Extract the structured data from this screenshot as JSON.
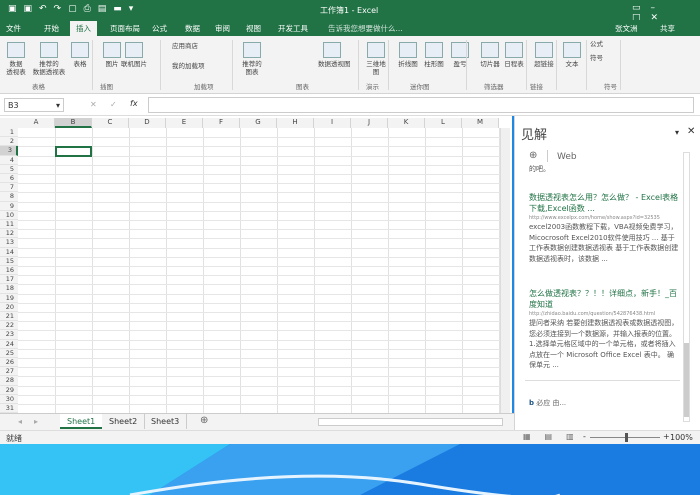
{
  "title": {
    "text": "工作簿1 - Excel",
    "quick_access": [
      "save-icon",
      "save-as-icon",
      "undo-icon",
      "redo-icon",
      "new-icon",
      "print-icon",
      "print-preview-icon",
      "open-icon"
    ]
  },
  "tabs": [
    "文件",
    "开始",
    "插入",
    "页面布局",
    "公式",
    "数据",
    "审阅",
    "视图",
    "开发工具"
  ],
  "active_tab": "插入",
  "tell_me": "告诉我您想要做什么...",
  "user": "张文洲",
  "share": "共享",
  "ribbon": {
    "buttons": [
      "数据\n透视表",
      "推荐的\n数据透视表",
      "表格",
      "图片",
      "联机图片",
      "应用商店",
      "我的加载项",
      "推荐的\n图表",
      "数据透视图",
      "三维地\n图",
      "折线图",
      "柱形图",
      "盈亏",
      "切片器",
      "日程表",
      "超链接",
      "文本",
      "公式",
      "符号"
    ],
    "groups": [
      "表格",
      "插图",
      "加载项",
      "图表",
      "演示",
      "迷你图",
      "筛选器",
      "链接",
      "符号"
    ]
  },
  "formula_bar": {
    "name_box": "B3",
    "cancel": "✕",
    "enter": "✓",
    "fx": "fx",
    "value": ""
  },
  "columns": [
    "A",
    "B",
    "C",
    "D",
    "E",
    "F",
    "G",
    "H",
    "I",
    "J",
    "K",
    "L",
    "M"
  ],
  "row_count": 31,
  "selected_cell": "B3",
  "pane": {
    "title": "见解",
    "nav": "Web",
    "top_text": "的吧。",
    "results": [
      {
        "title": "数据透视表怎么用？怎么做？ - Excel表格下载,Excel函数 ...",
        "url": "http://www.excelpx.com/home/show.aspx?id=32535",
        "desc": "excel2003函数教程下载，VBA视频免费学习，Micocrosoft Excel2010软件使用技巧 ... 基于工作表数据创建数据透视表 基于工作表数据创建数据透视表时，该数据 ..."
      },
      {
        "title": "怎么做透视表？？！！详细点，新手！_百度知道",
        "url": "http://zhidao.baidu.com/question/542876438.html",
        "desc": "提问者采纳 若要创建数据透视表或数据透视图，您必须连接到一个数据源，并输入报表的位置。 1.选择单元格区域中的一个单元格，或者将插入点放在一个 Microsoft Office Excel 表中。 确保单元 ..."
      }
    ],
    "footer": "必应 由..."
  },
  "sheets": [
    "Sheet1",
    "Sheet2",
    "Sheet3"
  ],
  "active_sheet": "Sheet1",
  "status": {
    "ready": "就绪",
    "zoom": "100%",
    "zoom_fraction": 0.5
  }
}
